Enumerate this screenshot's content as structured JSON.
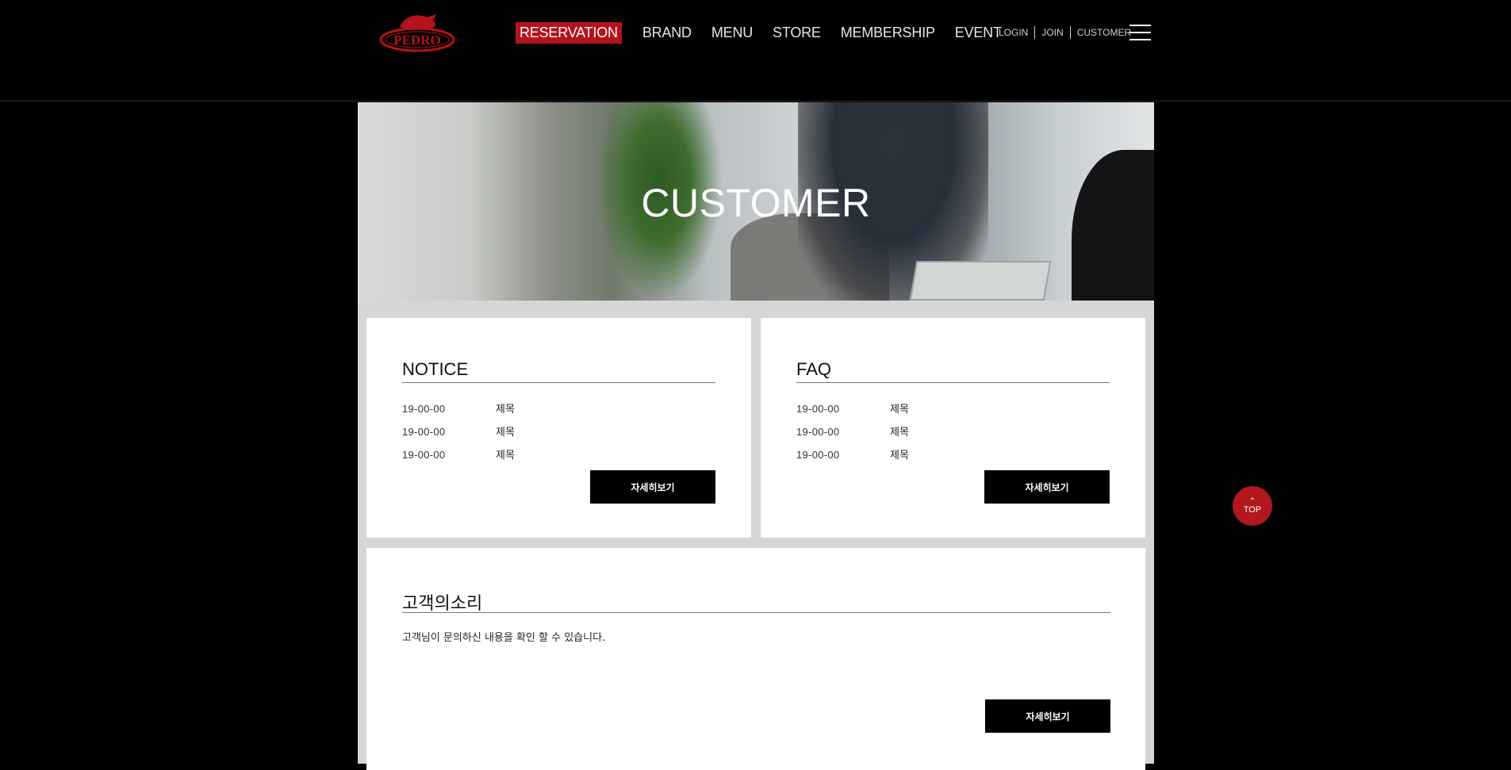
{
  "header": {
    "logo_text": "PEDRO",
    "nav": [
      "RESERVATION",
      "BRAND",
      "MENU",
      "STORE",
      "MEMBERSHIP",
      "EVENT"
    ],
    "util": [
      "LOGIN",
      "JOIN",
      "CUSTOMER"
    ],
    "accent_color": "#b5121b"
  },
  "banner": {
    "title": "CUSTOMER"
  },
  "notice": {
    "title": "NOTICE",
    "rows": [
      {
        "date": "19-00-00",
        "subject": "제목"
      },
      {
        "date": "19-00-00",
        "subject": "제목"
      },
      {
        "date": "19-00-00",
        "subject": "제목"
      }
    ],
    "button": "자세히보기"
  },
  "faq": {
    "title": "FAQ",
    "rows": [
      {
        "date": "19-00-00",
        "subject": "제목"
      },
      {
        "date": "19-00-00",
        "subject": "제목"
      },
      {
        "date": "19-00-00",
        "subject": "제목"
      }
    ],
    "button": "자세히보기"
  },
  "voice": {
    "title": "고객의소리",
    "description": "고객님이 문의하신 내용을 확인 할 수 있습니다.",
    "button": "자세히보기"
  },
  "top_button": {
    "label": "TOP",
    "icon": "chevron-up-icon"
  }
}
